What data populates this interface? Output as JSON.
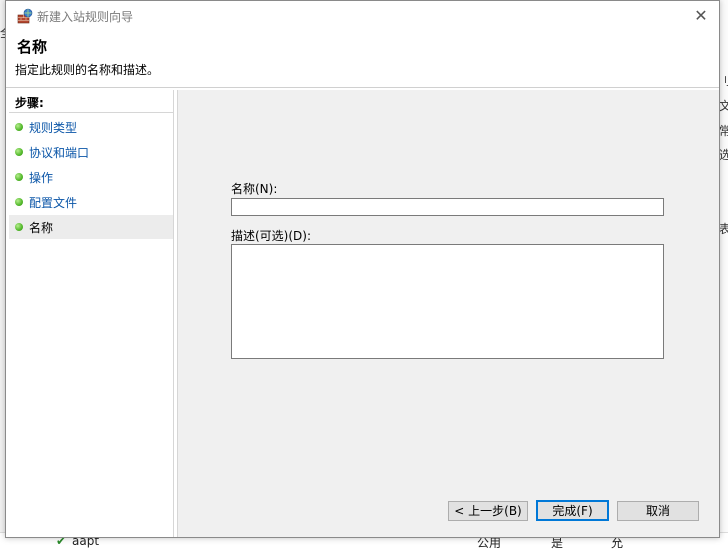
{
  "window": {
    "title": "新建入站规则向导",
    "close_glyph": "✕",
    "icon": "firewall-wizard-icon"
  },
  "header": {
    "title": "名称",
    "description": "指定此规则的名称和描述。"
  },
  "steps": {
    "heading": "步骤:",
    "items": [
      {
        "label": "规则类型",
        "active": false
      },
      {
        "label": "协议和端口",
        "active": false
      },
      {
        "label": "操作",
        "active": false
      },
      {
        "label": "配置文件",
        "active": false
      },
      {
        "label": "名称",
        "active": true
      }
    ]
  },
  "form": {
    "name_label": "名称(N):",
    "name_value": "",
    "description_label": "描述(可选)(D):",
    "description_value": ""
  },
  "buttons": {
    "back": "< 上一步(B)",
    "finish": "完成(F)",
    "cancel": "取消"
  },
  "background": {
    "side_chars": [
      "刂",
      "文",
      "常",
      "选",
      "表"
    ],
    "left_char": "全",
    "bottom_row": {
      "name": "aapt",
      "profile": "公用",
      "enabled": "是",
      "action": "允"
    }
  },
  "colors": {
    "link": "#0b56a8",
    "accent_border": "#0078d7",
    "content_bg": "#f0f0f0",
    "step_dot": "#52b82a"
  }
}
